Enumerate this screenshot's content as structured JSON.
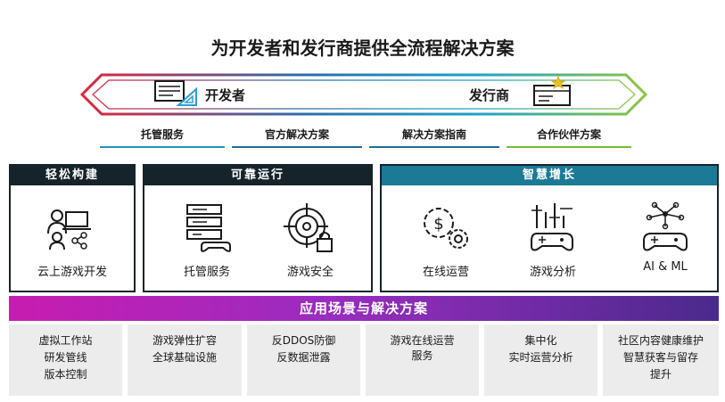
{
  "title": "为开发者和发行商提供全流程解决方案",
  "arrow": {
    "left_label": "开发者",
    "right_label": "发行商"
  },
  "tabs": [
    {
      "label": "托管服务"
    },
    {
      "label": "官方解决方案"
    },
    {
      "label": "解决方案指南"
    },
    {
      "label": "合作伙伴方案"
    }
  ],
  "panels": {
    "easy_build": {
      "header": "轻松构建",
      "items": [
        {
          "label": "云上游戏开发",
          "icon": "developer-laptop-icon"
        }
      ]
    },
    "reliable": {
      "header": "可靠运行",
      "items": [
        {
          "label": "托管服务",
          "icon": "server-gamepad-icon"
        },
        {
          "label": "游戏安全",
          "icon": "crosshair-lock-icon"
        }
      ]
    },
    "growth": {
      "header": "智慧增长",
      "items": [
        {
          "label": "在线运营",
          "icon": "dollar-gear-icon"
        },
        {
          "label": "游戏分析",
          "icon": "chart-gamepad-icon"
        },
        {
          "label": "AI & ML",
          "icon": "network-gamepad-icon"
        }
      ]
    }
  },
  "banner": "应用场景与解决方案",
  "scenarios": [
    {
      "lines": [
        "虚拟工作站",
        "研发管线",
        "版本控制"
      ]
    },
    {
      "lines": [
        "游戏弹性扩容",
        "全球基础设施"
      ]
    },
    {
      "lines": [
        "反DDOS防御",
        "反数据泄露"
      ]
    },
    {
      "lines": [
        "游戏在线运营",
        "服务"
      ]
    },
    {
      "lines": [
        "集中化",
        "实时运营分析"
      ]
    },
    {
      "lines": [
        "社区内容健康维护",
        "智慧获客与留存",
        "提升"
      ]
    }
  ],
  "colors": {
    "header_dark": "#16232b",
    "header_teal": "#1b7a96",
    "tab_bars": [
      "#2a8fb8",
      "#1e6f8f",
      "#1e6f8f",
      "#6fbf3a"
    ],
    "arrow_gradient": [
      "#e0243a",
      "#2a6fb0",
      "#1ea0c8",
      "#8cc63f"
    ]
  }
}
